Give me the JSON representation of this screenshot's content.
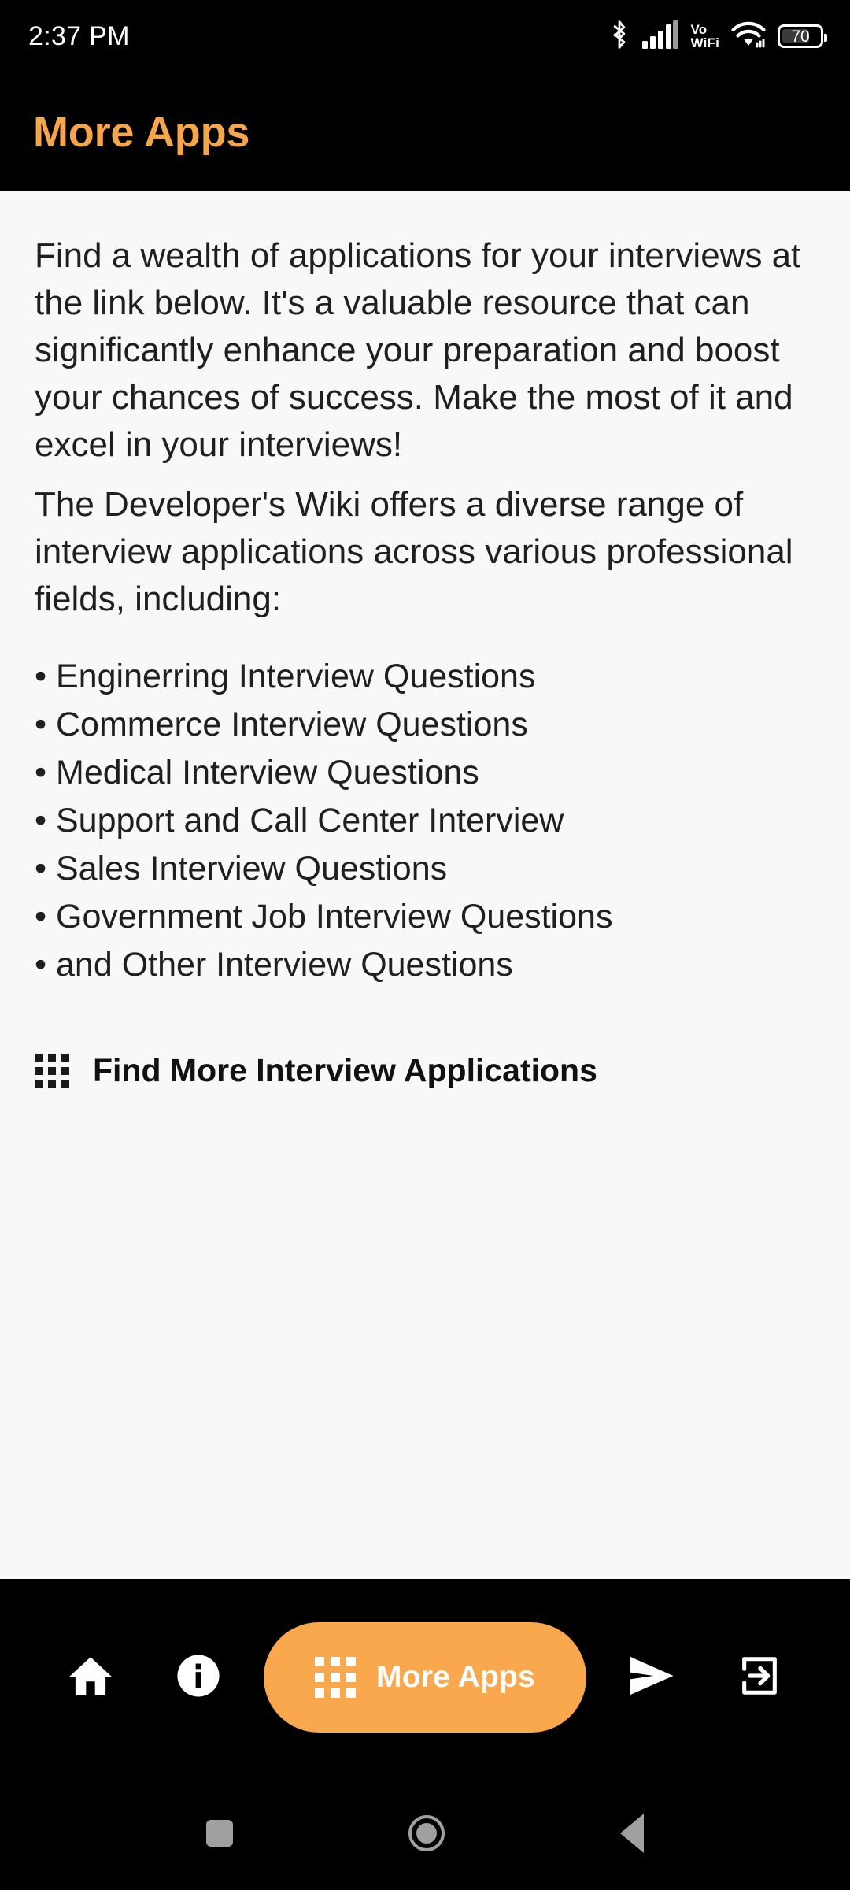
{
  "status_bar": {
    "time": "2:37 PM",
    "bluetooth_icon": "bluetooth-icon",
    "signal_icon": "cellular-signal-icon",
    "vowifi_line1": "Vo",
    "vowifi_line2": "WiFi",
    "wifi_icon": "wifi-icon",
    "battery_level": "70"
  },
  "app_bar": {
    "title": "More Apps",
    "title_color": "#F5A54A"
  },
  "content": {
    "paragraph_1": "Find a wealth of applications for your interviews at the link below. It's a valuable resource that can significantly enhance your preparation and boost your chances of success. Make the most of it and excel in your interviews!",
    "paragraph_2": "The Developer's Wiki offers a diverse range of interview applications across various professional fields, including:",
    "bullets": [
      "• Enginerring Interview Questions",
      "• Commerce Interview Questions",
      "• Medical Interview Questions",
      "• Support and Call Center Interview",
      "• Sales Interview Questions",
      "• Government Job Interview Questions",
      "• and Other Interview Questions"
    ],
    "find_more_label": "Find More Interview Applications",
    "find_more_icon": "apps-grid-icon",
    "background_color": "#F8F8F8"
  },
  "bottom_nav": {
    "home_icon": "home-icon",
    "info_icon": "info-icon",
    "more_apps_label": "More Apps",
    "more_apps_icon": "apps-grid-icon",
    "more_apps_color": "#F9A84D",
    "send_icon": "send-icon",
    "exit_icon": "exit-icon"
  },
  "system_nav": {
    "recents_icon": "recents-square-icon",
    "home_icon": "home-circle-icon",
    "back_icon": "back-triangle-icon"
  }
}
